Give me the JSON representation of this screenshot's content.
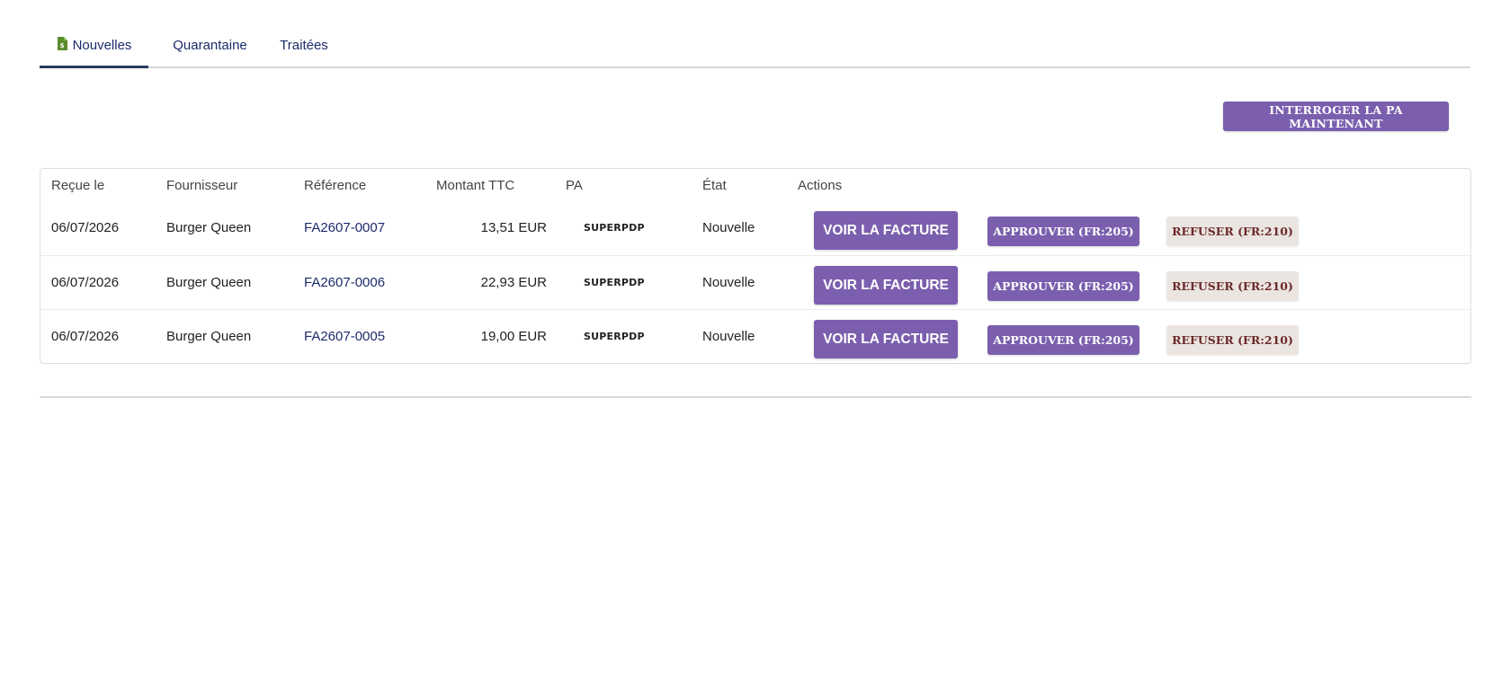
{
  "tabs": [
    {
      "label": "Nouvelles",
      "icon": "invoice-icon",
      "active": true
    },
    {
      "label": "Quarantaine",
      "active": false
    },
    {
      "label": "Traitées",
      "active": false
    }
  ],
  "toolbar": {
    "poll_label": "INTERROGER LA PA MAINTENANT"
  },
  "table": {
    "headers": [
      "Reçue le",
      "Fournisseur",
      "Référence",
      "Montant TTC",
      "PA",
      "État",
      "Actions"
    ],
    "rows": [
      {
        "date": "06/07/2026",
        "supplier": "Burger Queen",
        "reference": "FA2607-0007",
        "amount": "13,51 EUR",
        "pa": "SUPERPDP",
        "state": "Nouvelle"
      },
      {
        "date": "06/07/2026",
        "supplier": "Burger Queen",
        "reference": "FA2607-0006",
        "amount": "22,93 EUR",
        "pa": "SUPERPDP",
        "state": "Nouvelle"
      },
      {
        "date": "06/07/2026",
        "supplier": "Burger Queen",
        "reference": "FA2607-0005",
        "amount": "19,00 EUR",
        "pa": "SUPERPDP",
        "state": "Nouvelle"
      }
    ],
    "actions": {
      "view_label": "VOIR LA FACTURE",
      "approve_label": "APPROUVER (FR:205)",
      "refuse_label": "REFUSER (FR:210)"
    }
  },
  "colors": {
    "accent": "#7b5fae",
    "tab_active": "#263c5c",
    "link": "#1d2b6b",
    "refuse_bg": "#ebe5e1",
    "refuse_text": "#6b2a2a",
    "icon_green": "#5b8c2a"
  }
}
